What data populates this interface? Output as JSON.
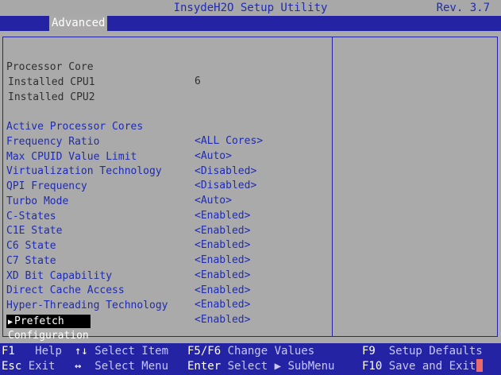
{
  "header": {
    "title": "InsydeH2O Setup Utility",
    "revision": "Rev. 3.7"
  },
  "menu": {
    "active_tab": "Advanced"
  },
  "info_rows": [
    {
      "label": "Processor Core",
      "value": "6"
    },
    {
      "label": "Installed CPU1",
      "value": ""
    },
    {
      "label": "Installed CPU2",
      "value": ""
    }
  ],
  "settings": [
    {
      "label": "Active Processor Cores",
      "value": "<ALL Cores>"
    },
    {
      "label": "Frequency Ratio",
      "value": "<Auto>"
    },
    {
      "label": "Max CPUID Value Limit",
      "value": "<Disabled>"
    },
    {
      "label": "Virtualization Technology",
      "value": "<Disabled>"
    },
    {
      "label": "QPI Frequency",
      "value": "<Auto>"
    },
    {
      "label": "Turbo Mode",
      "value": "<Enabled>"
    },
    {
      "label": "C-States",
      "value": "<Enabled>"
    },
    {
      "label": "C1E State",
      "value": "<Enabled>"
    },
    {
      "label": "C6 State",
      "value": "<Enabled>"
    },
    {
      "label": "C7 State",
      "value": "<Enabled>"
    },
    {
      "label": "XD Bit Capability",
      "value": "<Enabled>"
    },
    {
      "label": "Direct Cache Access",
      "value": "<Enabled>"
    },
    {
      "label": "Hyper-Threading Technology",
      "value": "<Enabled>"
    }
  ],
  "submenu": {
    "label": "Prefetch Configuration",
    "icon": "triangle-right-icon"
  },
  "footer": {
    "row1": [
      {
        "key": "F1",
        "desc": "Help"
      },
      {
        "key": "↑↓",
        "desc": "Select Item"
      },
      {
        "key": "F5/F6",
        "desc": "Change Values"
      },
      {
        "key": "F9",
        "desc": "Setup Defaults"
      }
    ],
    "row2": [
      {
        "key": "Esc",
        "desc": "Exit"
      },
      {
        "key": "↔",
        "desc": "Select Menu"
      },
      {
        "key": "Enter",
        "desc": "Select ▶ SubMenu"
      },
      {
        "key": "F10",
        "desc": "Save and Exit"
      }
    ]
  },
  "colors": {
    "background": "#aaaaaa",
    "bar_blue": "#2323a3",
    "text_blue": "#1f2bb0",
    "cursor_red": "#e86a6a"
  }
}
